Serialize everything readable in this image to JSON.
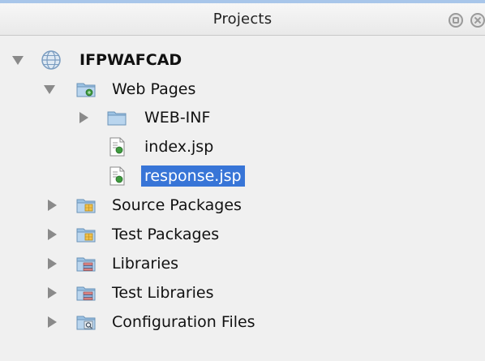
{
  "panel": {
    "title": "Projects"
  },
  "tree": {
    "project": {
      "label": "IFPWAFCAD",
      "icon": "globe-icon"
    },
    "web_pages": {
      "label": "Web Pages",
      "icon": "web-folder-icon"
    },
    "web_inf": {
      "label": "WEB-INF",
      "icon": "folder-icon"
    },
    "index_jsp": {
      "label": "index.jsp",
      "icon": "jsp-file-icon"
    },
    "response_jsp": {
      "label": "response.jsp",
      "icon": "jsp-file-icon",
      "selected": true
    },
    "source_packages": {
      "label": "Source Packages",
      "icon": "package-folder-icon"
    },
    "test_packages": {
      "label": "Test Packages",
      "icon": "package-folder-icon"
    },
    "libraries": {
      "label": "Libraries",
      "icon": "library-folder-icon"
    },
    "test_libraries": {
      "label": "Test Libraries",
      "icon": "library-folder-icon"
    },
    "configuration_files": {
      "label": "Configuration Files",
      "icon": "config-folder-icon"
    }
  },
  "colors": {
    "selection": "#3875d7",
    "folder": "#8fb7d9",
    "accent": "#a8c6ea"
  }
}
